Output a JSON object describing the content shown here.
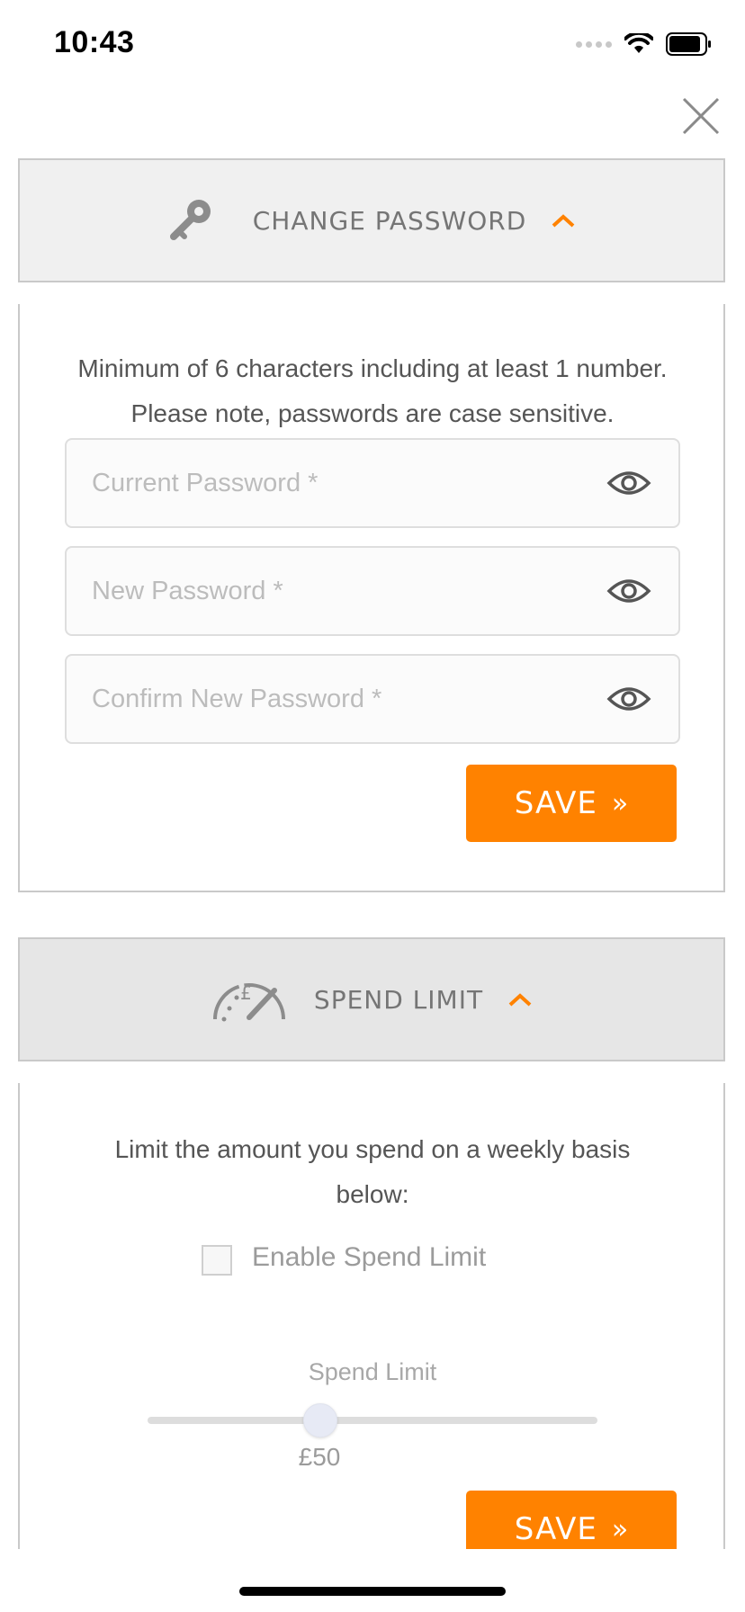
{
  "status_bar": {
    "time": "10:43"
  },
  "change_password": {
    "title": "CHANGE PASSWORD",
    "description": "Minimum of 6 characters including at least 1 number. Please note, passwords are case sensitive.",
    "fields": [
      {
        "placeholder": "Current Password *",
        "value": ""
      },
      {
        "placeholder": "New Password *",
        "value": ""
      },
      {
        "placeholder": "Confirm New Password *",
        "value": ""
      }
    ],
    "save_label": "SAVE",
    "save_arrows": "»"
  },
  "spend_limit": {
    "title": "SPEND LIMIT",
    "description": "Limit the amount you spend on a weekly basis below:",
    "checkbox_label": "Enable Spend Limit",
    "checkbox_checked": false,
    "slider_title": "Spend Limit",
    "slider_value": "£50",
    "save_label": "SAVE",
    "save_arrows": "»"
  },
  "colors": {
    "accent": "#ff8200",
    "header_bg": "#f0f0f0",
    "header_bg_alt": "#e6e6e6",
    "border": "#c9c9c9"
  },
  "icons": [
    "key-icon",
    "speedometer-pound-icon",
    "chevron-up-icon",
    "eye-icon",
    "close-icon",
    "wifi-icon",
    "battery-icon"
  ]
}
